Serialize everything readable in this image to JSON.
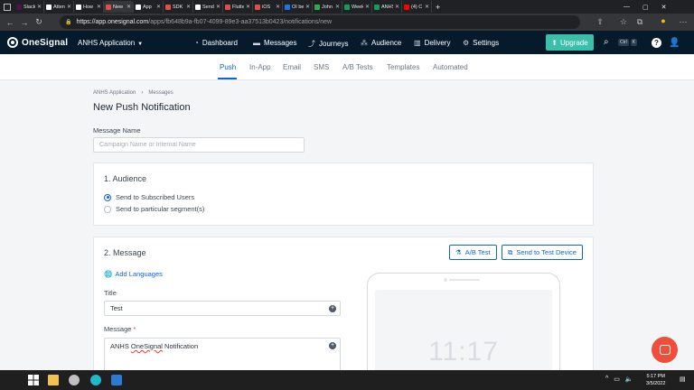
{
  "browser": {
    "tabs": [
      {
        "label": "Slack",
        "color": "#4a154b"
      },
      {
        "label": "Atten",
        "color": "#ffffff"
      },
      {
        "label": "How",
        "color": "#ffffff"
      },
      {
        "label": "New",
        "color": "#e54b4b",
        "active": true
      },
      {
        "label": "App",
        "color": "#ffffff"
      },
      {
        "label": "SDK",
        "color": "#e54b4b"
      },
      {
        "label": "Send",
        "color": "#ffffff"
      },
      {
        "label": "Flutte",
        "color": "#e54b4b"
      },
      {
        "label": "iOS",
        "color": "#e54b4b"
      },
      {
        "label": "OI be",
        "color": "#1a73e8"
      },
      {
        "label": "John",
        "color": "#34a853"
      },
      {
        "label": "Week",
        "color": "#0f9d58"
      },
      {
        "label": "ANHS",
        "color": "#0f9d58"
      },
      {
        "label": "(4) C",
        "color": "#ff0000"
      }
    ],
    "url_host": "https://app.onesignal.com",
    "url_rest": "/apps/fb648b9a-fb07-4099-89e3-aa37513b0423/notifications/new"
  },
  "header": {
    "logo_text": "OneSignal",
    "app_name": "ANHS Application",
    "nav": [
      {
        "label": "Dashboard",
        "icon": "dashboard-icon"
      },
      {
        "label": "Messages",
        "icon": "messages-icon"
      },
      {
        "label": "Journeys",
        "icon": "journeys-icon"
      },
      {
        "label": "Audience",
        "icon": "audience-icon"
      },
      {
        "label": "Delivery",
        "icon": "delivery-icon"
      },
      {
        "label": "Settings",
        "icon": "gear-icon"
      }
    ],
    "upgrade_label": "Upgrade",
    "kbd": [
      "Ctrl",
      "K"
    ],
    "help": "?"
  },
  "subnav": [
    "Push",
    "In-App",
    "Email",
    "SMS",
    "A/B Tests",
    "Templates",
    "Automated"
  ],
  "breadcrumb": [
    "ANHS Application",
    "Messages"
  ],
  "page_title": "New Push Notification",
  "message_name": {
    "label": "Message Name",
    "placeholder": "Campaign Name or Internal Name"
  },
  "audience": {
    "title": "1. Audience",
    "options": [
      "Send to Subscribed Users",
      "Send to particular segment(s)"
    ],
    "selected": 0
  },
  "message": {
    "title": "2. Message",
    "ab_test_label": "A/B Test",
    "test_device_label": "Send to Test Device",
    "add_languages_label": "Add Languages",
    "title_label": "Title",
    "title_value": "Test",
    "body_label": "Message",
    "body_value_prefix": "ANHS ",
    "body_value_misspelled": "OneSignal",
    "body_value_suffix": " Notification"
  },
  "phone": {
    "time": "11:17"
  },
  "taskbar": {
    "time": "5:17 PM",
    "date": "3/5/2022"
  },
  "colors": {
    "brand_dark": "#051b2c",
    "accent": "#0f63d6",
    "upgrade": "#3bbfa8",
    "chat": "#ef4e3a"
  }
}
